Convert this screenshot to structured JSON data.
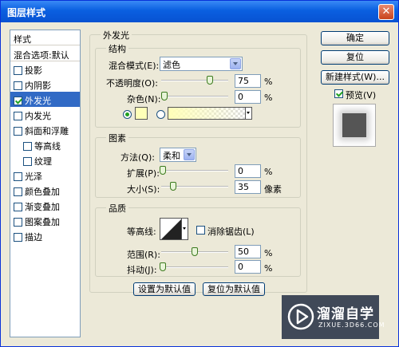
{
  "window": {
    "title": "图层样式",
    "close_glyph": "✕"
  },
  "left": {
    "header": "样式",
    "blend": "混合选项:默认",
    "items": [
      {
        "label": "投影",
        "checked": false,
        "indent": false
      },
      {
        "label": "内阴影",
        "checked": false,
        "indent": false
      },
      {
        "label": "外发光",
        "checked": true,
        "indent": false,
        "selected": true
      },
      {
        "label": "内发光",
        "checked": false,
        "indent": false
      },
      {
        "label": "斜面和浮雕",
        "checked": false,
        "indent": false
      },
      {
        "label": "等高线",
        "checked": false,
        "indent": true
      },
      {
        "label": "纹理",
        "checked": false,
        "indent": true
      },
      {
        "label": "光泽",
        "checked": false,
        "indent": false
      },
      {
        "label": "颜色叠加",
        "checked": false,
        "indent": false
      },
      {
        "label": "渐变叠加",
        "checked": false,
        "indent": false
      },
      {
        "label": "图案叠加",
        "checked": false,
        "indent": false
      },
      {
        "label": "描边",
        "checked": false,
        "indent": false
      }
    ]
  },
  "outer": {
    "title": "外发光",
    "structure": {
      "title": "结构",
      "blend_label": "混合模式(E):",
      "blend_value": "滤色",
      "opacity_label": "不透明度(O):",
      "opacity": "75",
      "opacity_fraction": 0.75,
      "noise_label": "杂色(N):",
      "noise": "0",
      "noise_fraction": 0,
      "percent": "%",
      "solid_color": "#ffffb8",
      "gradient_from": "#ffffb8"
    },
    "elements": {
      "title": "图素",
      "method_label": "方法(Q):",
      "method_value": "柔和",
      "spread_label": "扩展(P):",
      "spread": "0",
      "spread_fraction": 0,
      "size_label": "大小(S):",
      "size": "35",
      "size_fraction": 0.14,
      "percent": "%",
      "unit": "像素"
    },
    "quality": {
      "title": "品质",
      "contour_label": "等高线:",
      "antialias_label": "消除锯齿(L)",
      "range_label": "范围(R):",
      "range": "50",
      "range_fraction": 0.5,
      "jitter_label": "抖动(J):",
      "jitter": "0",
      "jitter_fraction": 0,
      "percent": "%"
    },
    "default_button": "设置为默认值",
    "reset_button": "复位为默认值"
  },
  "right": {
    "ok": "确定",
    "reset": "复位",
    "new_style": "新建样式(W)...",
    "preview_label": "预览(V)",
    "preview_checked": true
  },
  "watermark": {
    "brand": "溜溜自学",
    "url": "ZIXUE.3D66.COM"
  }
}
